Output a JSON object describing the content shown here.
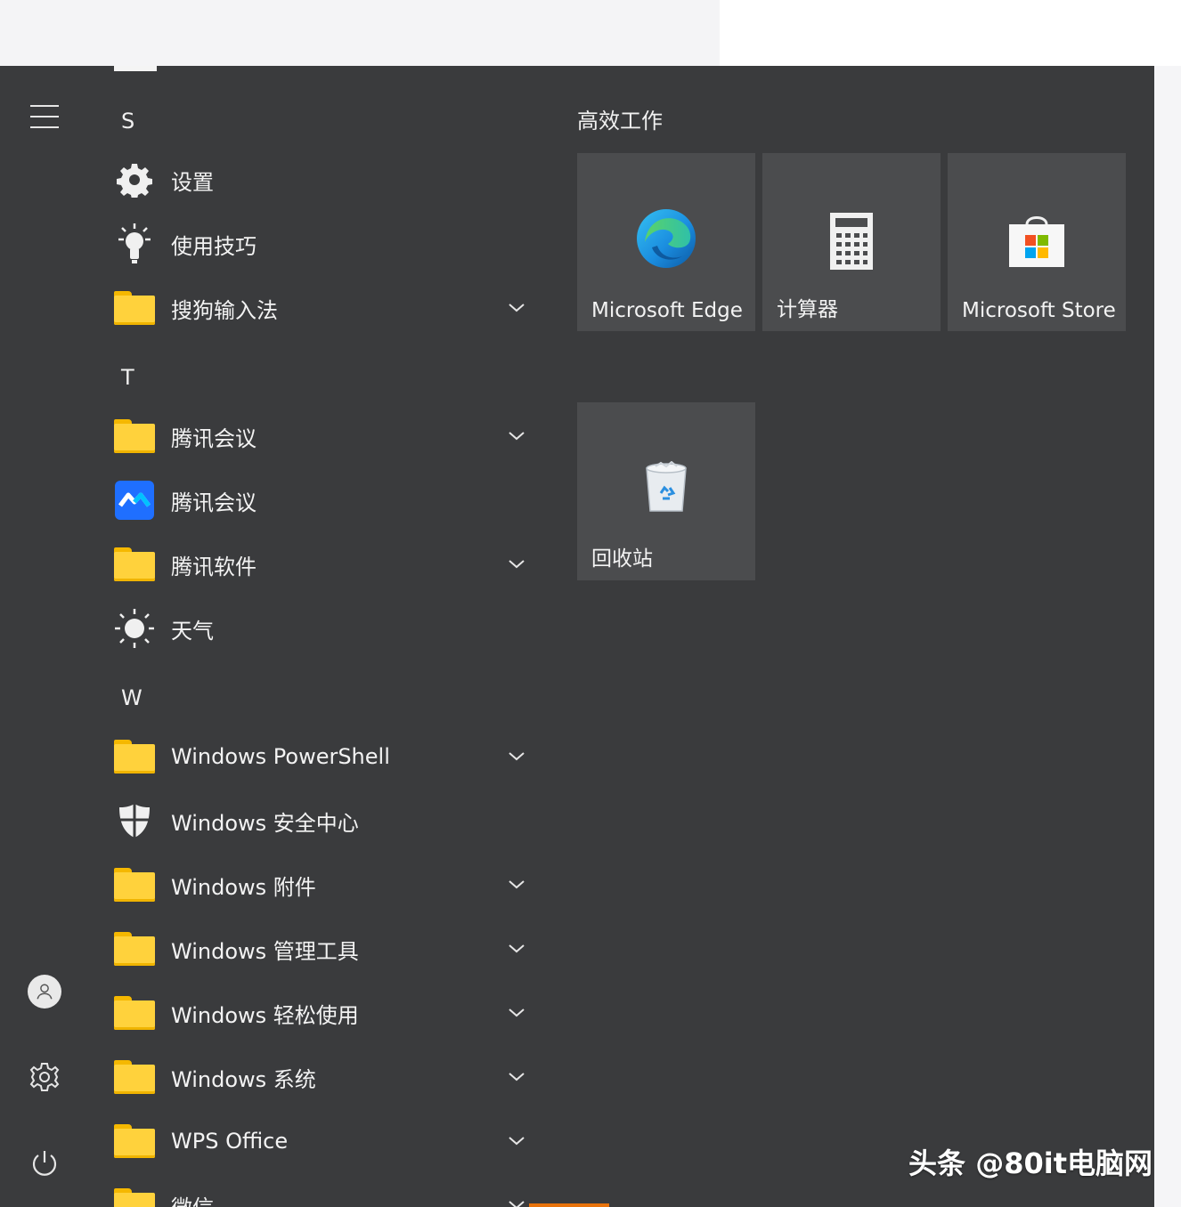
{
  "rail": {
    "menu_icon": "hamburger-icon",
    "user_icon": "user-avatar-icon",
    "settings_icon": "gear-icon",
    "power_icon": "power-icon"
  },
  "apps": {
    "letter_s": "S",
    "settings": "设置",
    "tips": "使用技巧",
    "sogou": "搜狗输入法",
    "letter_t": "T",
    "tencent_meeting_folder": "腾讯会议",
    "tencent_meeting": "腾讯会议",
    "tencent_software": "腾讯软件",
    "weather": "天气",
    "letter_w": "W",
    "powershell": "Windows PowerShell",
    "security": "Windows 安全中心",
    "accessories": "Windows 附件",
    "admin_tools": "Windows 管理工具",
    "ease_access": "Windows 轻松使用",
    "system": "Windows 系统",
    "wps": "WPS Office",
    "wechat": "微信"
  },
  "tiles": {
    "group_title": "高效工作",
    "edge": "Microsoft Edge",
    "calculator": "计算器",
    "store": "Microsoft Store",
    "recycle_bin": "回收站"
  },
  "watermark": "头条 @80it电脑网",
  "colors": {
    "menu_bg": "#3a3b3d",
    "tile_bg": "#4b4c4e",
    "folder": "#ffd23c",
    "accent_orange": "#e8730c"
  }
}
